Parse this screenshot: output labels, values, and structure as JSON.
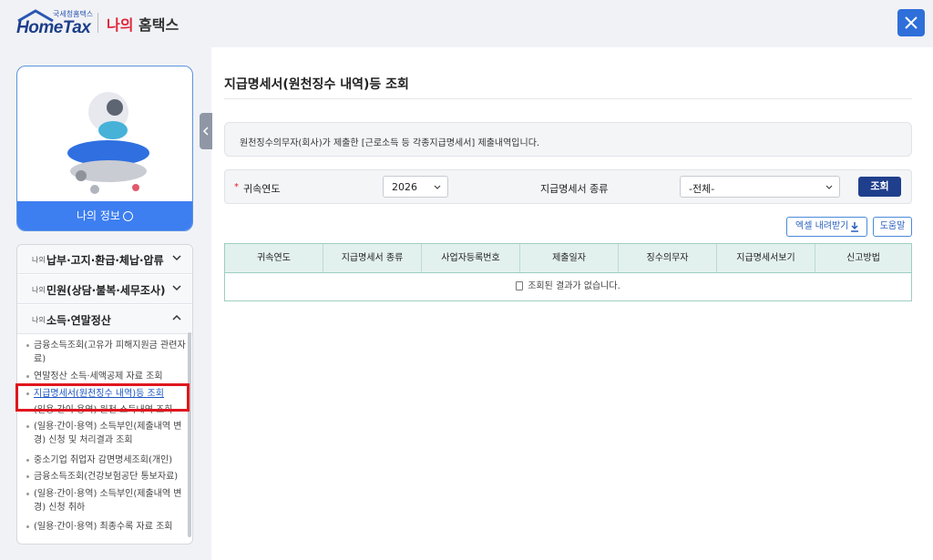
{
  "header": {
    "logo_small": "국세청홈택스",
    "logo_main": "HomeTax",
    "brand_accent": "나의",
    "brand_rest": " 홈택스"
  },
  "profile": {
    "button_label": "나의 정보"
  },
  "menu": {
    "sections": [
      {
        "small": "나의",
        "label": "납부·고지·환급·체납·압류",
        "expanded": false
      },
      {
        "small": "나의",
        "label": "민원(상담·불복·세무조사)",
        "expanded": false
      },
      {
        "small": "나의",
        "label": "소득·연말정산",
        "expanded": true
      }
    ],
    "sub_items": [
      "금융소득조회(고유가 피해지원금 관련자료)",
      "연말정산 소득·세액공제 자료 조회",
      "지급명세서(원천징수 내역)등 조회",
      "(일용·간이·용역) 원천 소득내역 조회",
      "(일용·간이·용역) 소득부인(제출내역 변경) 신청 및 처리결과 조회",
      "중소기업 취업자 감면명세조회(개인)",
      "금융소득조회(건강보험공단 통보자료)",
      "(일용·간이·용역) 소득부인(제출내역 변경) 신청 취하",
      "(일용·간이·용역) 최종수록 자료 조회"
    ],
    "active_index": 2
  },
  "main": {
    "title": "지급명세서(원천징수 내역)등 조회",
    "info": "원천징수의무자(회사)가 제출한 [근로소득 등 각종지급명세서] 제출내역입니다.",
    "filter": {
      "required_mark": "*",
      "year_label": "귀속연도",
      "year_value": "2026",
      "type_label": "지급명세서 종류",
      "type_value": "-전체-",
      "search_label": "조회"
    },
    "excel_label": "엑셀 내려받기",
    "help_label": "도움말",
    "table": {
      "columns": [
        "귀속연도",
        "지급명세서 종류",
        "사업자등록번호",
        "제출일자",
        "징수의무자",
        "지급명세서보기",
        "신고방법"
      ],
      "empty_message": "조회된 결과가 없습니다."
    }
  },
  "colors": {
    "primary": "#3d7ef0",
    "navy": "#1f3f8c",
    "highlight": "#e0161e",
    "table_header": "#e3f1ee"
  }
}
